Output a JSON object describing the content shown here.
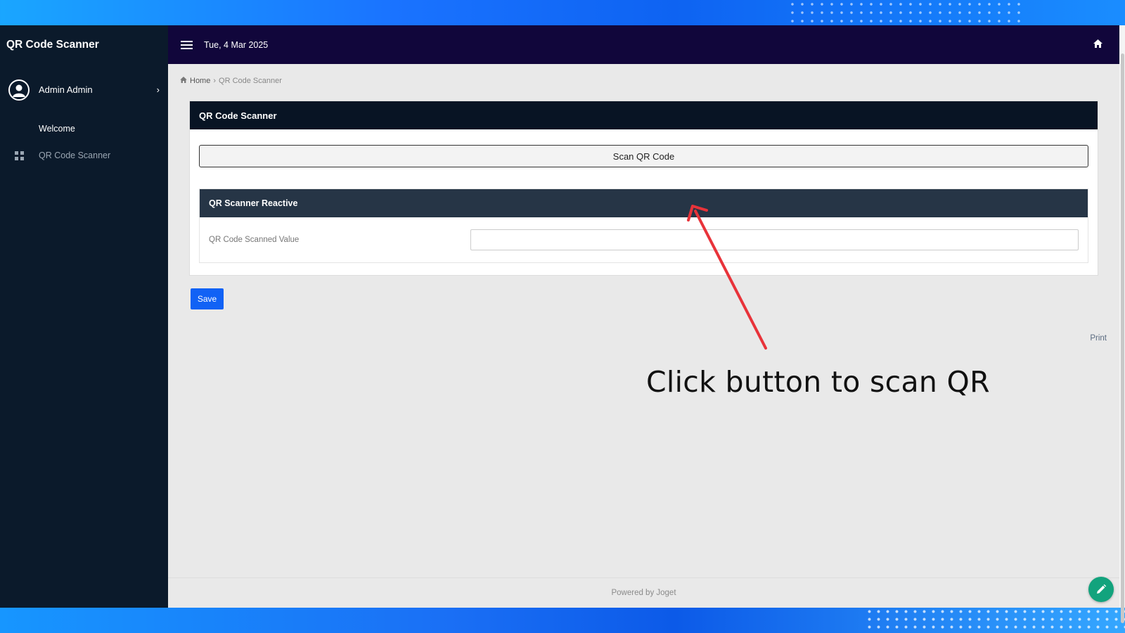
{
  "app": {
    "title": "QR Code Scanner"
  },
  "sidebar": {
    "user_name": "Admin Admin",
    "items": [
      {
        "label": "Welcome"
      },
      {
        "label": "QR Code Scanner",
        "icon": "grid-icon"
      }
    ]
  },
  "topbar": {
    "date": "Tue, 4 Mar 2025",
    "home_icon": "home-icon"
  },
  "breadcrumb": {
    "home": "Home",
    "separator": "›",
    "current": "QR Code Scanner"
  },
  "form": {
    "card_title": "QR Code Scanner",
    "scan_button_label": "Scan QR Code",
    "section_title": "QR Scanner Reactive",
    "field_label": "QR Code Scanned Value",
    "field_value": "",
    "save_label": "Save",
    "print_label": "Print"
  },
  "annotation": {
    "text": "Click button to scan QR",
    "arrow_color": "#e8333a"
  },
  "footer": {
    "text": "Powered by Joget"
  },
  "colors": {
    "sidebar_bg": "#0b1a2b",
    "topbar_bg": "#11063b",
    "card_header_bg": "#081424",
    "section_header_bg": "#263546",
    "save_button_bg": "#1162f5",
    "fab_bg": "#12a37d"
  }
}
